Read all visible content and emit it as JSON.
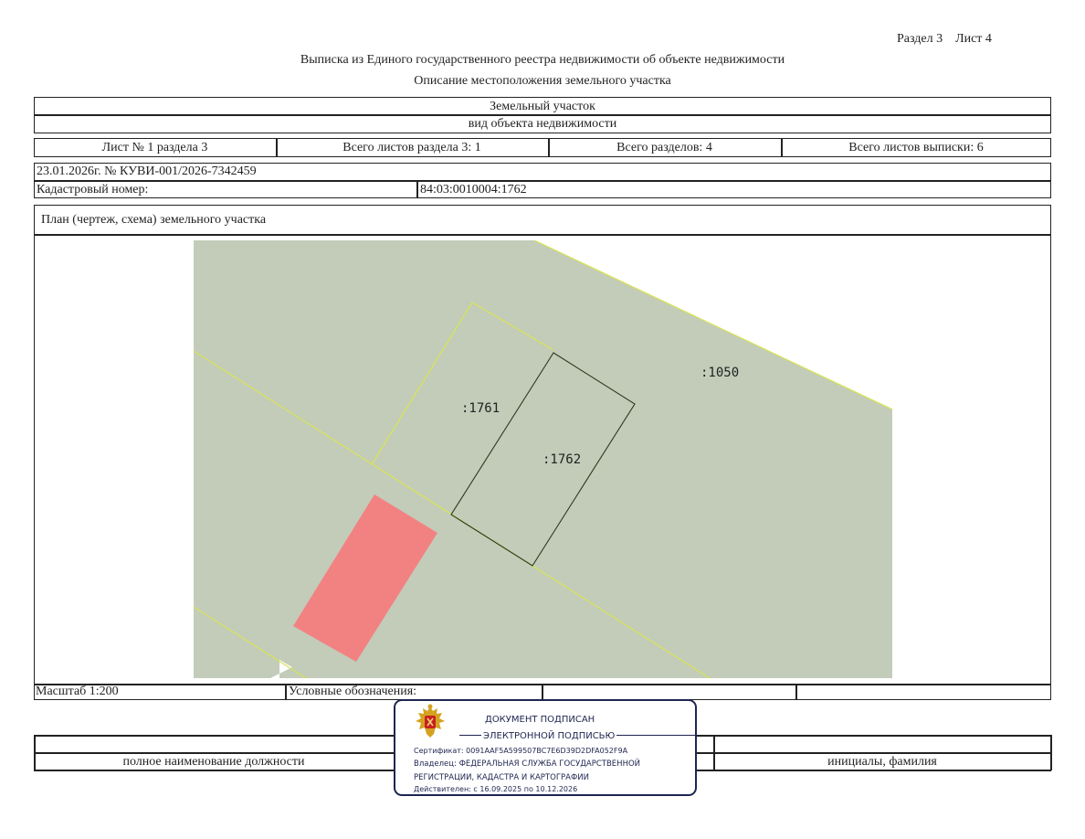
{
  "header": {
    "section_sheet": "Раздел 3    Лист 4",
    "title": "Выписка из Единого государственного реестра недвижимости об объекте недвижимости",
    "subtitle": "Описание местоположения земельного участка"
  },
  "object": {
    "type": "Земельный участок",
    "type_caption": "вид объекта недвижимости"
  },
  "sheet_info": {
    "sheet": "Лист № 1 раздела 3",
    "total_section_sheets": "Всего листов раздела 3: 1",
    "total_sections": "Всего разделов: 4",
    "total_extract_sheets": "Всего листов выписки: 6"
  },
  "record": {
    "date_number": "23.01.2026г. № КУВИ-001/2026-7342459",
    "cadastral_label": "Кадастровый номер:",
    "cadastral_number": "84:03:0010004:1762"
  },
  "plan": {
    "title": "План (чертеж, схема) земельного участка",
    "parcels": [
      ":1050",
      ":1761",
      ":1762"
    ],
    "colors": {
      "background": "#c2ccb9",
      "boundary": "#d9e25a",
      "target_outline": "#2b3a1c",
      "building": "#f28282"
    }
  },
  "footer": {
    "scale": "Масштаб 1:200",
    "legend_label": "Условные обозначения:",
    "position_caption": "полное наименование должности",
    "name_caption": "инициалы, фамилия"
  },
  "stamp": {
    "line1": "ДОКУМЕНТ ПОДПИСАН",
    "line2": "ЭЛЕКТРОННОЙ ПОДПИСЬЮ",
    "certificate": "Сертификат: 0091AAF5A599507BC7E6D39D2DFA052F9A",
    "owner_line1": "Владелец: ФЕДЕРАЛЬНАЯ СЛУЖБА ГОСУДАРСТВЕННОЙ",
    "owner_line2": "РЕГИСТРАЦИИ, КАДАСТРА И КАРТОГРАФИИ",
    "validity": "Действителен: с 16.09.2025 по 10.12.2026"
  }
}
